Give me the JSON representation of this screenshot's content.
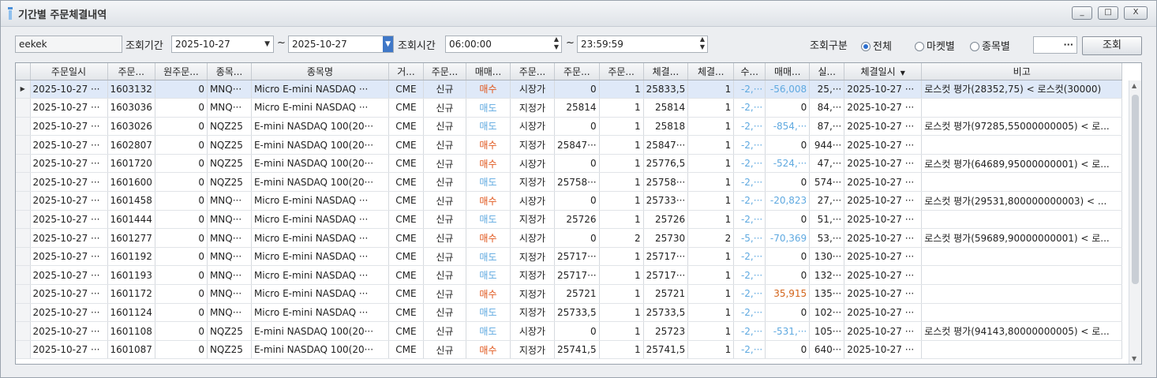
{
  "window": {
    "title": "기간별 주문체결내역",
    "min": "_",
    "max": "□",
    "close": "X"
  },
  "filters": {
    "account": "eekek",
    "period_label": "조회기간",
    "date_from": "2025-10-27",
    "tilde": "~",
    "date_to": "2025-10-27",
    "time_label": "조회시간",
    "time_from": "06:00:00",
    "time_to": "23:59:59",
    "type_label": "조회구분",
    "radio_all": "전체",
    "radio_market": "마켓별",
    "radio_symbol": "종목별",
    "selected": "전체",
    "more": "···",
    "search_button": "조회"
  },
  "columns": [
    "주문일시",
    "주문...",
    "원주문...",
    "종목...",
    "종목명",
    "거...",
    "주문...",
    "매매...",
    "주문...",
    "주문...",
    "주문...",
    "체결...",
    "체결...",
    "수...",
    "매매...",
    "실...",
    "체결일시",
    "비고"
  ],
  "sort_indicator": "▼",
  "rows": [
    [
      "2025-10-27 ···",
      "1603132",
      "0",
      "MNQ···",
      "Micro E-mini NASDAQ ···",
      "CME",
      "신규",
      "매수",
      "시장가",
      "0",
      "1",
      "25833,5",
      "1",
      "-2,···",
      "-56,008",
      "25,···",
      "2025-10-27 ···",
      "로스컷 평가(28352,75) < 로스컷(30000)"
    ],
    [
      "2025-10-27 ···",
      "1603036",
      "0",
      "MNQ···",
      "Micro E-mini NASDAQ ···",
      "CME",
      "신규",
      "매도",
      "지정가",
      "25814",
      "1",
      "25814",
      "1",
      "-2,···",
      "0",
      "84,···",
      "2025-10-27 ···",
      ""
    ],
    [
      "2025-10-27 ···",
      "1603026",
      "0",
      "NQZ25",
      "E-mini NASDAQ 100(20···",
      "CME",
      "신규",
      "매도",
      "시장가",
      "0",
      "1",
      "25818",
      "1",
      "-2,···",
      "-854,···",
      "87,···",
      "2025-10-27 ···",
      "로스컷 평가(97285,55000000005) < 로..."
    ],
    [
      "2025-10-27 ···",
      "1602807",
      "0",
      "NQZ25",
      "E-mini NASDAQ 100(20···",
      "CME",
      "신규",
      "매수",
      "지정가",
      "25847···",
      "1",
      "25847···",
      "1",
      "-2,···",
      "0",
      "944···",
      "2025-10-27 ···",
      ""
    ],
    [
      "2025-10-27 ···",
      "1601720",
      "0",
      "NQZ25",
      "E-mini NASDAQ 100(20···",
      "CME",
      "신규",
      "매수",
      "시장가",
      "0",
      "1",
      "25776,5",
      "1",
      "-2,···",
      "-524,···",
      "47,···",
      "2025-10-27 ···",
      "로스컷 평가(64689,95000000001) < 로..."
    ],
    [
      "2025-10-27 ···",
      "1601600",
      "0",
      "NQZ25",
      "E-mini NASDAQ 100(20···",
      "CME",
      "신규",
      "매도",
      "지정가",
      "25758···",
      "1",
      "25758···",
      "1",
      "-2,···",
      "0",
      "574···",
      "2025-10-27 ···",
      ""
    ],
    [
      "2025-10-27 ···",
      "1601458",
      "0",
      "MNQ···",
      "Micro E-mini NASDAQ ···",
      "CME",
      "신규",
      "매수",
      "시장가",
      "0",
      "1",
      "25733···",
      "1",
      "-2,···",
      "-20,823",
      "27,···",
      "2025-10-27 ···",
      "로스컷 평가(29531,800000000003) < ..."
    ],
    [
      "2025-10-27 ···",
      "1601444",
      "0",
      "MNQ···",
      "Micro E-mini NASDAQ ···",
      "CME",
      "신규",
      "매도",
      "지정가",
      "25726",
      "1",
      "25726",
      "1",
      "-2,···",
      "0",
      "51,···",
      "2025-10-27 ···",
      ""
    ],
    [
      "2025-10-27 ···",
      "1601277",
      "0",
      "MNQ···",
      "Micro E-mini NASDAQ ···",
      "CME",
      "신규",
      "매수",
      "시장가",
      "0",
      "2",
      "25730",
      "2",
      "-5,···",
      "-70,369",
      "53,···",
      "2025-10-27 ···",
      "로스컷 평가(59689,90000000001) < 로..."
    ],
    [
      "2025-10-27 ···",
      "1601192",
      "0",
      "MNQ···",
      "Micro E-mini NASDAQ ···",
      "CME",
      "신규",
      "매도",
      "지정가",
      "25717···",
      "1",
      "25717···",
      "1",
      "-2,···",
      "0",
      "130···",
      "2025-10-27 ···",
      ""
    ],
    [
      "2025-10-27 ···",
      "1601193",
      "0",
      "MNQ···",
      "Micro E-mini NASDAQ ···",
      "CME",
      "신규",
      "매도",
      "지정가",
      "25717···",
      "1",
      "25717···",
      "1",
      "-2,···",
      "0",
      "132···",
      "2025-10-27 ···",
      ""
    ],
    [
      "2025-10-27 ···",
      "1601172",
      "0",
      "MNQ···",
      "Micro E-mini NASDAQ ···",
      "CME",
      "신규",
      "매수",
      "지정가",
      "25721",
      "1",
      "25721",
      "1",
      "-2,···",
      "35,915",
      "135···",
      "2025-10-27 ···",
      ""
    ],
    [
      "2025-10-27 ···",
      "1601124",
      "0",
      "MNQ···",
      "Micro E-mini NASDAQ ···",
      "CME",
      "신규",
      "매도",
      "지정가",
      "25733,5",
      "1",
      "25733,5",
      "1",
      "-2,···",
      "0",
      "102···",
      "2025-10-27 ···",
      ""
    ],
    [
      "2025-10-27 ···",
      "1601108",
      "0",
      "NQZ25",
      "E-mini NASDAQ 100(20···",
      "CME",
      "신규",
      "매도",
      "시장가",
      "0",
      "1",
      "25723",
      "1",
      "-2,···",
      "-531,···",
      "105···",
      "2025-10-27 ···",
      "로스컷 평가(94143,80000000005) < 로..."
    ],
    [
      "2025-10-27 ···",
      "1601087",
      "0",
      "NQZ25",
      "E-mini NASDAQ 100(20···",
      "CME",
      "신규",
      "매수",
      "지정가",
      "25741,5",
      "1",
      "25741,5",
      "1",
      "-2,···",
      "0",
      "640···",
      "2025-10-27 ···",
      ""
    ]
  ],
  "colors": {
    "buy": "#e0561c",
    "sell": "#5fa9e0",
    "selected_row": "#dfe9f8"
  }
}
